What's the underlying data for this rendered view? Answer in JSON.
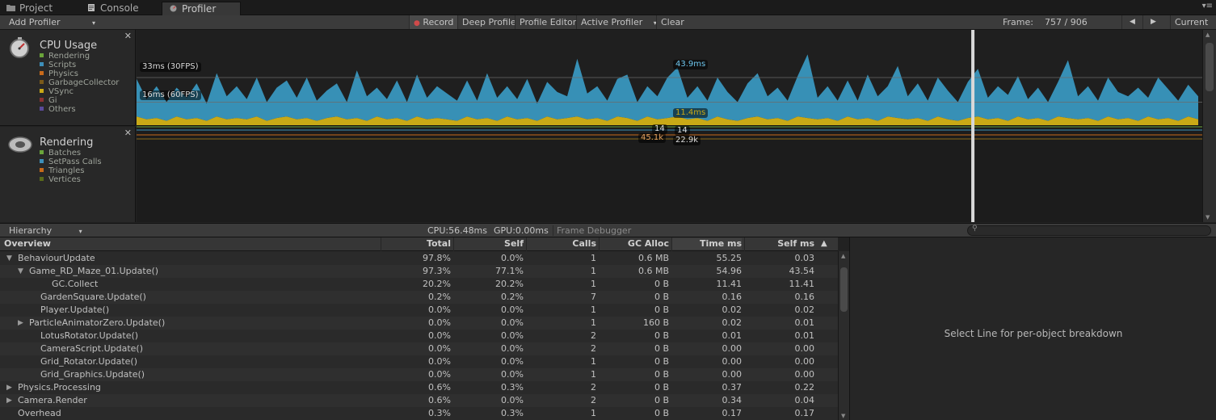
{
  "tabs": [
    {
      "label": "Project",
      "icon": "folder-icon",
      "active": false
    },
    {
      "label": "Console",
      "icon": "console-icon",
      "active": false
    },
    {
      "label": "Profiler",
      "icon": "profiler-icon",
      "active": true
    }
  ],
  "toolbar": {
    "add_profiler": "Add Profiler",
    "record": "Record",
    "deep_profile": "Deep Profile",
    "profile_editor": "Profile Editor",
    "active_profiler": "Active Profiler",
    "clear": "Clear",
    "frame_label": "Frame:",
    "frame_value": "757 / 906",
    "current": "Current"
  },
  "cpu_panel": {
    "title": "CPU Usage",
    "legend": [
      {
        "name": "Rendering",
        "color": "#6aa43a"
      },
      {
        "name": "Scripts",
        "color": "#3d8fb9"
      },
      {
        "name": "Physics",
        "color": "#c86a1a"
      },
      {
        "name": "GarbageCollector",
        "color": "#7a5a1a"
      },
      {
        "name": "VSync",
        "color": "#c9a916"
      },
      {
        "name": "Gi",
        "color": "#8a3232"
      },
      {
        "name": "Others",
        "color": "#5a4a9a"
      }
    ]
  },
  "rendering_panel": {
    "title": "Rendering",
    "legend": [
      {
        "name": "Batches",
        "color": "#6aa43a"
      },
      {
        "name": "SetPass Calls",
        "color": "#3d8fb9"
      },
      {
        "name": "Triangles",
        "color": "#c86a1a"
      },
      {
        "name": "Vertices",
        "color": "#5a6a1a"
      }
    ]
  },
  "graph": {
    "line_33": "33ms (30FPS)",
    "line_16": "16ms (60FPS)",
    "sel_total": "43.9ms",
    "sel_scripts": "11.4ms",
    "batches_left": "14",
    "batches_right": "14",
    "tris_left": "45.1k",
    "tris_right": "22.9k"
  },
  "chart_data": {
    "type": "area",
    "title": "",
    "ylim": [
      0,
      66
    ],
    "reference_lines": [
      {
        "label": "33ms (30FPS)",
        "y": 33
      },
      {
        "label": "16ms (60FPS)",
        "y": 16
      }
    ],
    "selected_frame": 757,
    "frames_total": 906,
    "selected_values": {
      "total_ms": 43.9,
      "scripts_ms": 11.4
    },
    "series": [
      {
        "name": "Scripts",
        "color": "#3a9cc7",
        "values": [
          26,
          14,
          22,
          13,
          20,
          15,
          24,
          12,
          30,
          16,
          22,
          14,
          27,
          13,
          21,
          25,
          15,
          28,
          14,
          19,
          23,
          12,
          33,
          17,
          20,
          14,
          26,
          13,
          29,
          15,
          22,
          18,
          14,
          25,
          13,
          31,
          16,
          21,
          14,
          27,
          12,
          24,
          19,
          15,
          40,
          18,
          22,
          14,
          26,
          30,
          13,
          21,
          16,
          28,
          34,
          15,
          22,
          14,
          27,
          19,
          13,
          24,
          30,
          16,
          21,
          14,
          28,
          44,
          15,
          22,
          14,
          25,
          13,
          30,
          17,
          21,
          36,
          16,
          24,
          14,
          27,
          20,
          13,
          25,
          33,
          15,
          22,
          18,
          28,
          14,
          21,
          13,
          24,
          40,
          16,
          22,
          14,
          27,
          19,
          15,
          23,
          13,
          29,
          20,
          14,
          22,
          16
        ]
      },
      {
        "name": "VSync",
        "color": "#c9a916",
        "values": [
          6,
          4,
          5,
          3,
          6,
          4,
          5,
          3,
          6,
          4,
          5,
          4,
          6,
          3,
          5,
          6,
          4,
          5,
          3,
          5,
          6,
          4,
          5,
          3,
          6,
          4,
          5,
          3,
          6,
          4,
          5,
          4,
          3,
          6,
          4,
          5,
          3,
          6,
          4,
          5,
          3,
          6,
          4,
          5,
          6,
          4,
          5,
          3,
          6,
          5,
          3,
          6,
          4,
          5,
          6,
          4,
          5,
          3,
          6,
          4,
          3,
          5,
          6,
          4,
          5,
          3,
          6,
          5,
          4,
          5,
          3,
          6,
          4,
          5,
          3,
          6,
          5,
          4,
          5,
          3,
          6,
          4,
          3,
          5,
          6,
          4,
          5,
          3,
          6,
          4,
          5,
          3,
          6,
          5,
          4,
          5,
          3,
          6,
          4,
          5,
          3,
          6,
          4,
          5,
          3,
          6,
          4
        ]
      }
    ]
  },
  "hierarchy_bar": {
    "view": "Hierarchy",
    "cpu": "CPU:56.48ms",
    "gpu": "GPU:0.00ms",
    "frame_debugger": "Frame Debugger"
  },
  "table": {
    "headers": [
      "Overview",
      "Total",
      "Self",
      "Calls",
      "GC Alloc",
      "Time ms",
      "Self ms"
    ],
    "rows": [
      {
        "name": "BehaviourUpdate",
        "indent": 0,
        "expander": "open",
        "total": "97.8%",
        "self": "0.0%",
        "calls": "1",
        "gc": "0.6 MB",
        "time": "55.25",
        "selfms": "0.03"
      },
      {
        "name": "Game_RD_Maze_01.Update()",
        "indent": 1,
        "expander": "open",
        "total": "97.3%",
        "self": "77.1%",
        "calls": "1",
        "gc": "0.6 MB",
        "time": "54.96",
        "selfms": "43.54"
      },
      {
        "name": "GC.Collect",
        "indent": 3,
        "expander": "none",
        "total": "20.2%",
        "self": "20.2%",
        "calls": "1",
        "gc": "0 B",
        "time": "11.41",
        "selfms": "11.41"
      },
      {
        "name": "GardenSquare.Update()",
        "indent": 2,
        "expander": "none",
        "total": "0.2%",
        "self": "0.2%",
        "calls": "7",
        "gc": "0 B",
        "time": "0.16",
        "selfms": "0.16"
      },
      {
        "name": "Player.Update()",
        "indent": 2,
        "expander": "none",
        "total": "0.0%",
        "self": "0.0%",
        "calls": "1",
        "gc": "0 B",
        "time": "0.02",
        "selfms": "0.02"
      },
      {
        "name": "ParticleAnimatorZero.Update()",
        "indent": 1,
        "expander": "closed",
        "total": "0.0%",
        "self": "0.0%",
        "calls": "1",
        "gc": "160 B",
        "time": "0.02",
        "selfms": "0.01"
      },
      {
        "name": "LotusRotator.Update()",
        "indent": 2,
        "expander": "none",
        "total": "0.0%",
        "self": "0.0%",
        "calls": "2",
        "gc": "0 B",
        "time": "0.01",
        "selfms": "0.01"
      },
      {
        "name": "CameraScript.Update()",
        "indent": 2,
        "expander": "none",
        "total": "0.0%",
        "self": "0.0%",
        "calls": "2",
        "gc": "0 B",
        "time": "0.00",
        "selfms": "0.00"
      },
      {
        "name": "Grid_Rotator.Update()",
        "indent": 2,
        "expander": "none",
        "total": "0.0%",
        "self": "0.0%",
        "calls": "1",
        "gc": "0 B",
        "time": "0.00",
        "selfms": "0.00"
      },
      {
        "name": "Grid_Graphics.Update()",
        "indent": 2,
        "expander": "none",
        "total": "0.0%",
        "self": "0.0%",
        "calls": "1",
        "gc": "0 B",
        "time": "0.00",
        "selfms": "0.00"
      },
      {
        "name": "Physics.Processing",
        "indent": 0,
        "expander": "closed",
        "total": "0.6%",
        "self": "0.3%",
        "calls": "2",
        "gc": "0 B",
        "time": "0.37",
        "selfms": "0.22"
      },
      {
        "name": "Camera.Render",
        "indent": 0,
        "expander": "closed",
        "total": "0.6%",
        "self": "0.0%",
        "calls": "2",
        "gc": "0 B",
        "time": "0.34",
        "selfms": "0.04"
      },
      {
        "name": "Overhead",
        "indent": 0,
        "expander": "none",
        "total": "0.3%",
        "self": "0.3%",
        "calls": "1",
        "gc": "0 B",
        "time": "0.17",
        "selfms": "0.17"
      }
    ]
  },
  "detail": {
    "message": "Select Line for per-object breakdown"
  }
}
